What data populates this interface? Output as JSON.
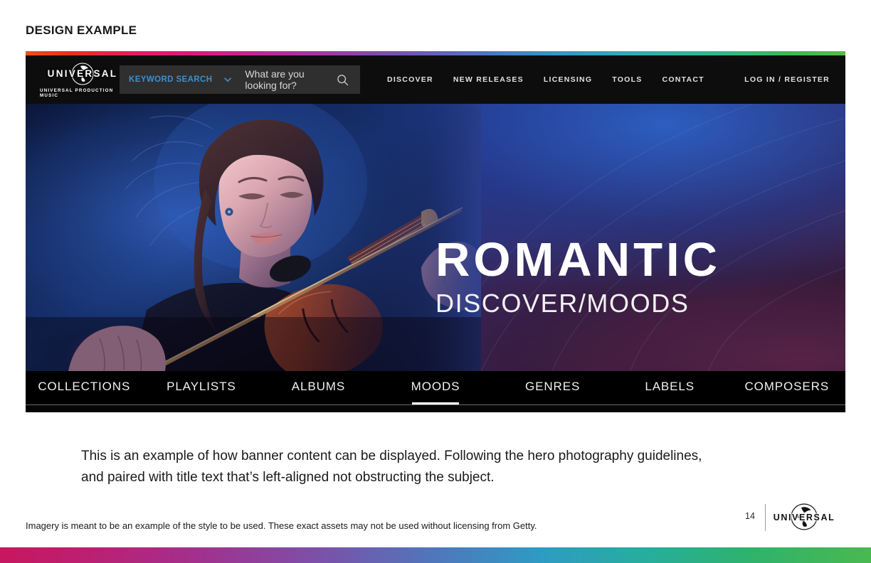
{
  "slide": {
    "title": "DESIGN EXAMPLE",
    "page_number": "14"
  },
  "banner": {
    "header": {
      "logo": {
        "wordmark": "UNIVERSAL",
        "tagline": "UNIVERSAL PRODUCTION MUSIC",
        "icon": "globe-icon"
      },
      "search": {
        "filter_label": "KEYWORD SEARCH",
        "filter_chevron_icon": "chevron-down-icon",
        "placeholder": "What are you looking for?",
        "value": "",
        "submit_icon": "search-icon"
      },
      "nav": [
        {
          "label": "DISCOVER"
        },
        {
          "label": "NEW RELEASES"
        },
        {
          "label": "LICENSING"
        },
        {
          "label": "TOOLS"
        },
        {
          "label": "CONTACT"
        }
      ],
      "account_label": "LOG IN / REGISTER"
    },
    "hero": {
      "title": "ROMANTIC",
      "subtitle": "DISCOVER/MOODS",
      "image_description": "Female violinist playing violin lit with blue and magenta stage lighting"
    },
    "tabs": [
      {
        "label": "COLLECTIONS",
        "active": false
      },
      {
        "label": "PLAYLISTS",
        "active": false
      },
      {
        "label": "ALBUMS",
        "active": false
      },
      {
        "label": "MOODS",
        "active": true
      },
      {
        "label": "GENRES",
        "active": false
      },
      {
        "label": "LABELS",
        "active": false
      },
      {
        "label": "COMPOSERS",
        "active": false
      }
    ]
  },
  "body_copy": "This is an example of how banner content can be displayed. Following the hero photography guidelines, and paired with title text that’s left-aligned not obstructing the subject.",
  "disclaimer": "Imagery is meant to be an example of the style to be used. These exact assets may not be used without licensing from Getty.",
  "footer": {
    "logo_wordmark": "UNIVERSAL",
    "logo_icon": "globe-icon"
  },
  "colors": {
    "accent_blue": "#3f8fce",
    "header_black": "#0d0d0d",
    "search_field": "#2f2f2f",
    "rainbow_start": "#e8521d",
    "rainbow_end": "#57bb49",
    "bottom_bar_start": "#c7175f",
    "bottom_bar_end": "#49b94f"
  }
}
